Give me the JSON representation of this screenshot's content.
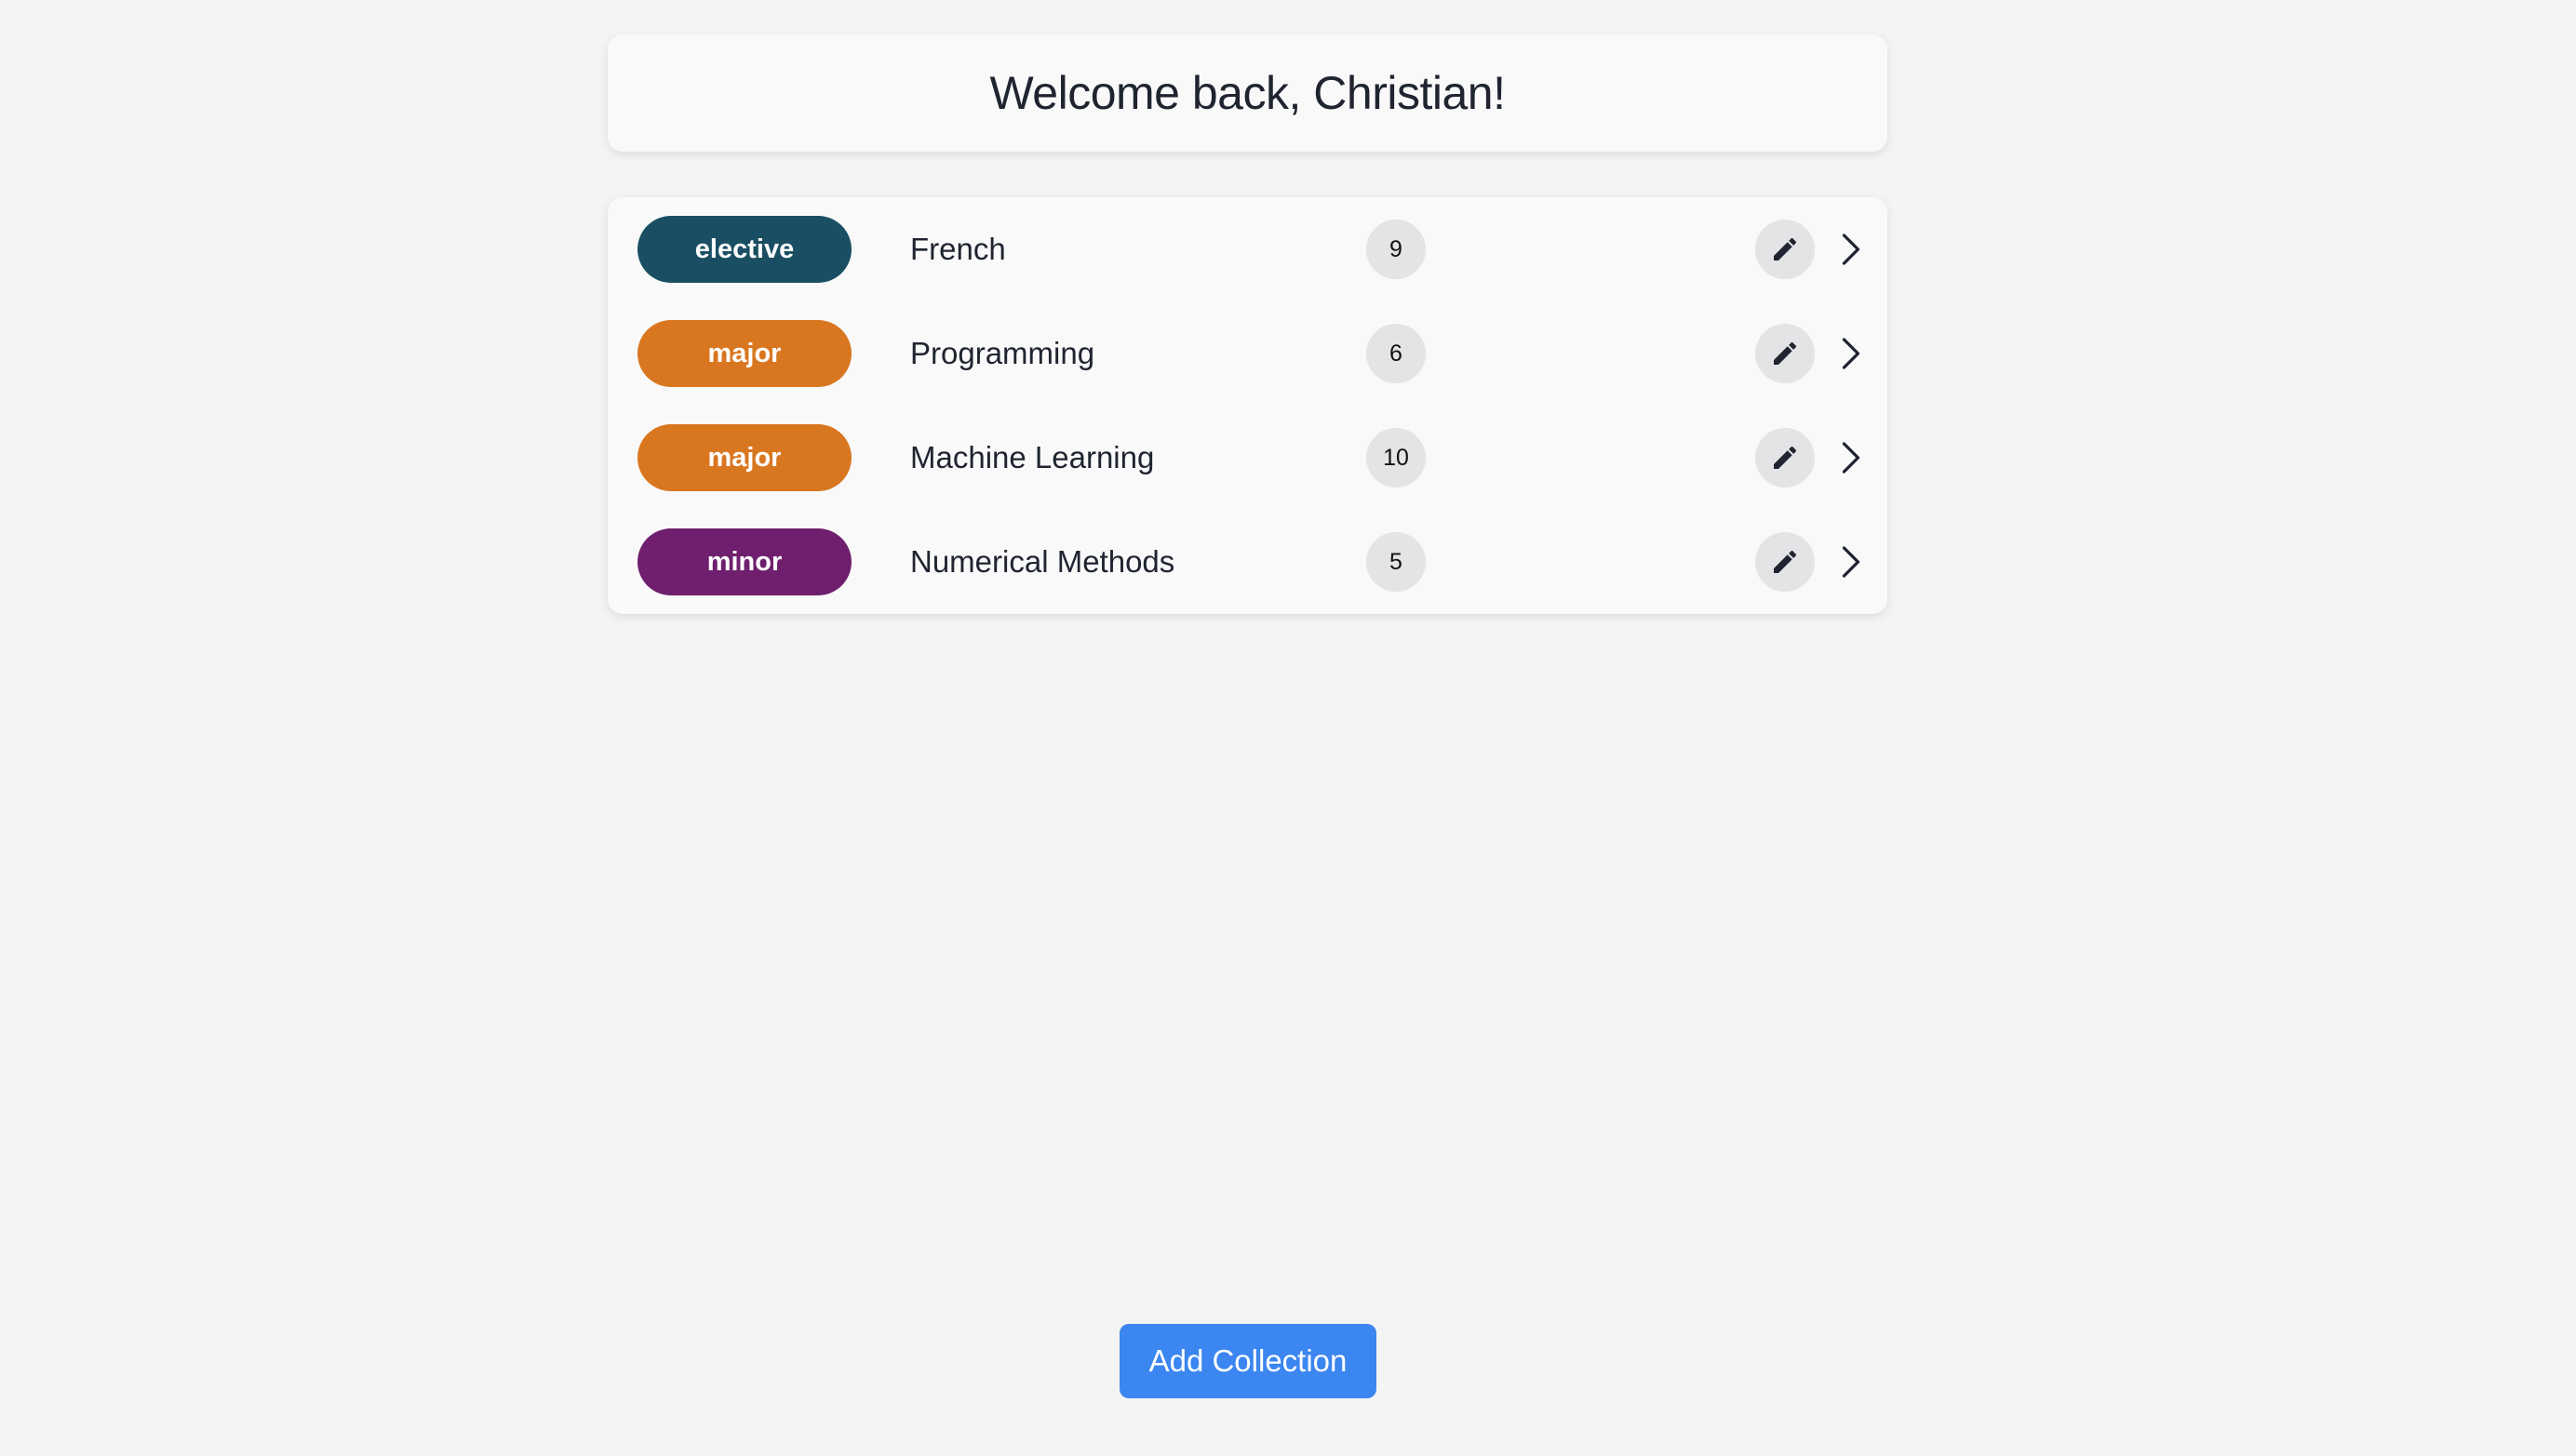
{
  "header": {
    "welcome": "Welcome back, Christian!"
  },
  "collections": [
    {
      "tag": "elective",
      "tag_color": "#1a4f63",
      "name": "French",
      "count": "9"
    },
    {
      "tag": "major",
      "tag_color": "#d97720",
      "name": "Programming",
      "count": "6"
    },
    {
      "tag": "major",
      "tag_color": "#d97720",
      "name": "Machine Learning",
      "count": "10"
    },
    {
      "tag": "minor",
      "tag_color": "#6f1f6e",
      "name": "Numerical Methods",
      "count": "5"
    }
  ],
  "icons": {
    "edit": "pencil-icon",
    "open": "chevron-right-icon"
  },
  "actions": {
    "add_collection": "Add Collection",
    "add_collection_color": "#3b86f0"
  }
}
